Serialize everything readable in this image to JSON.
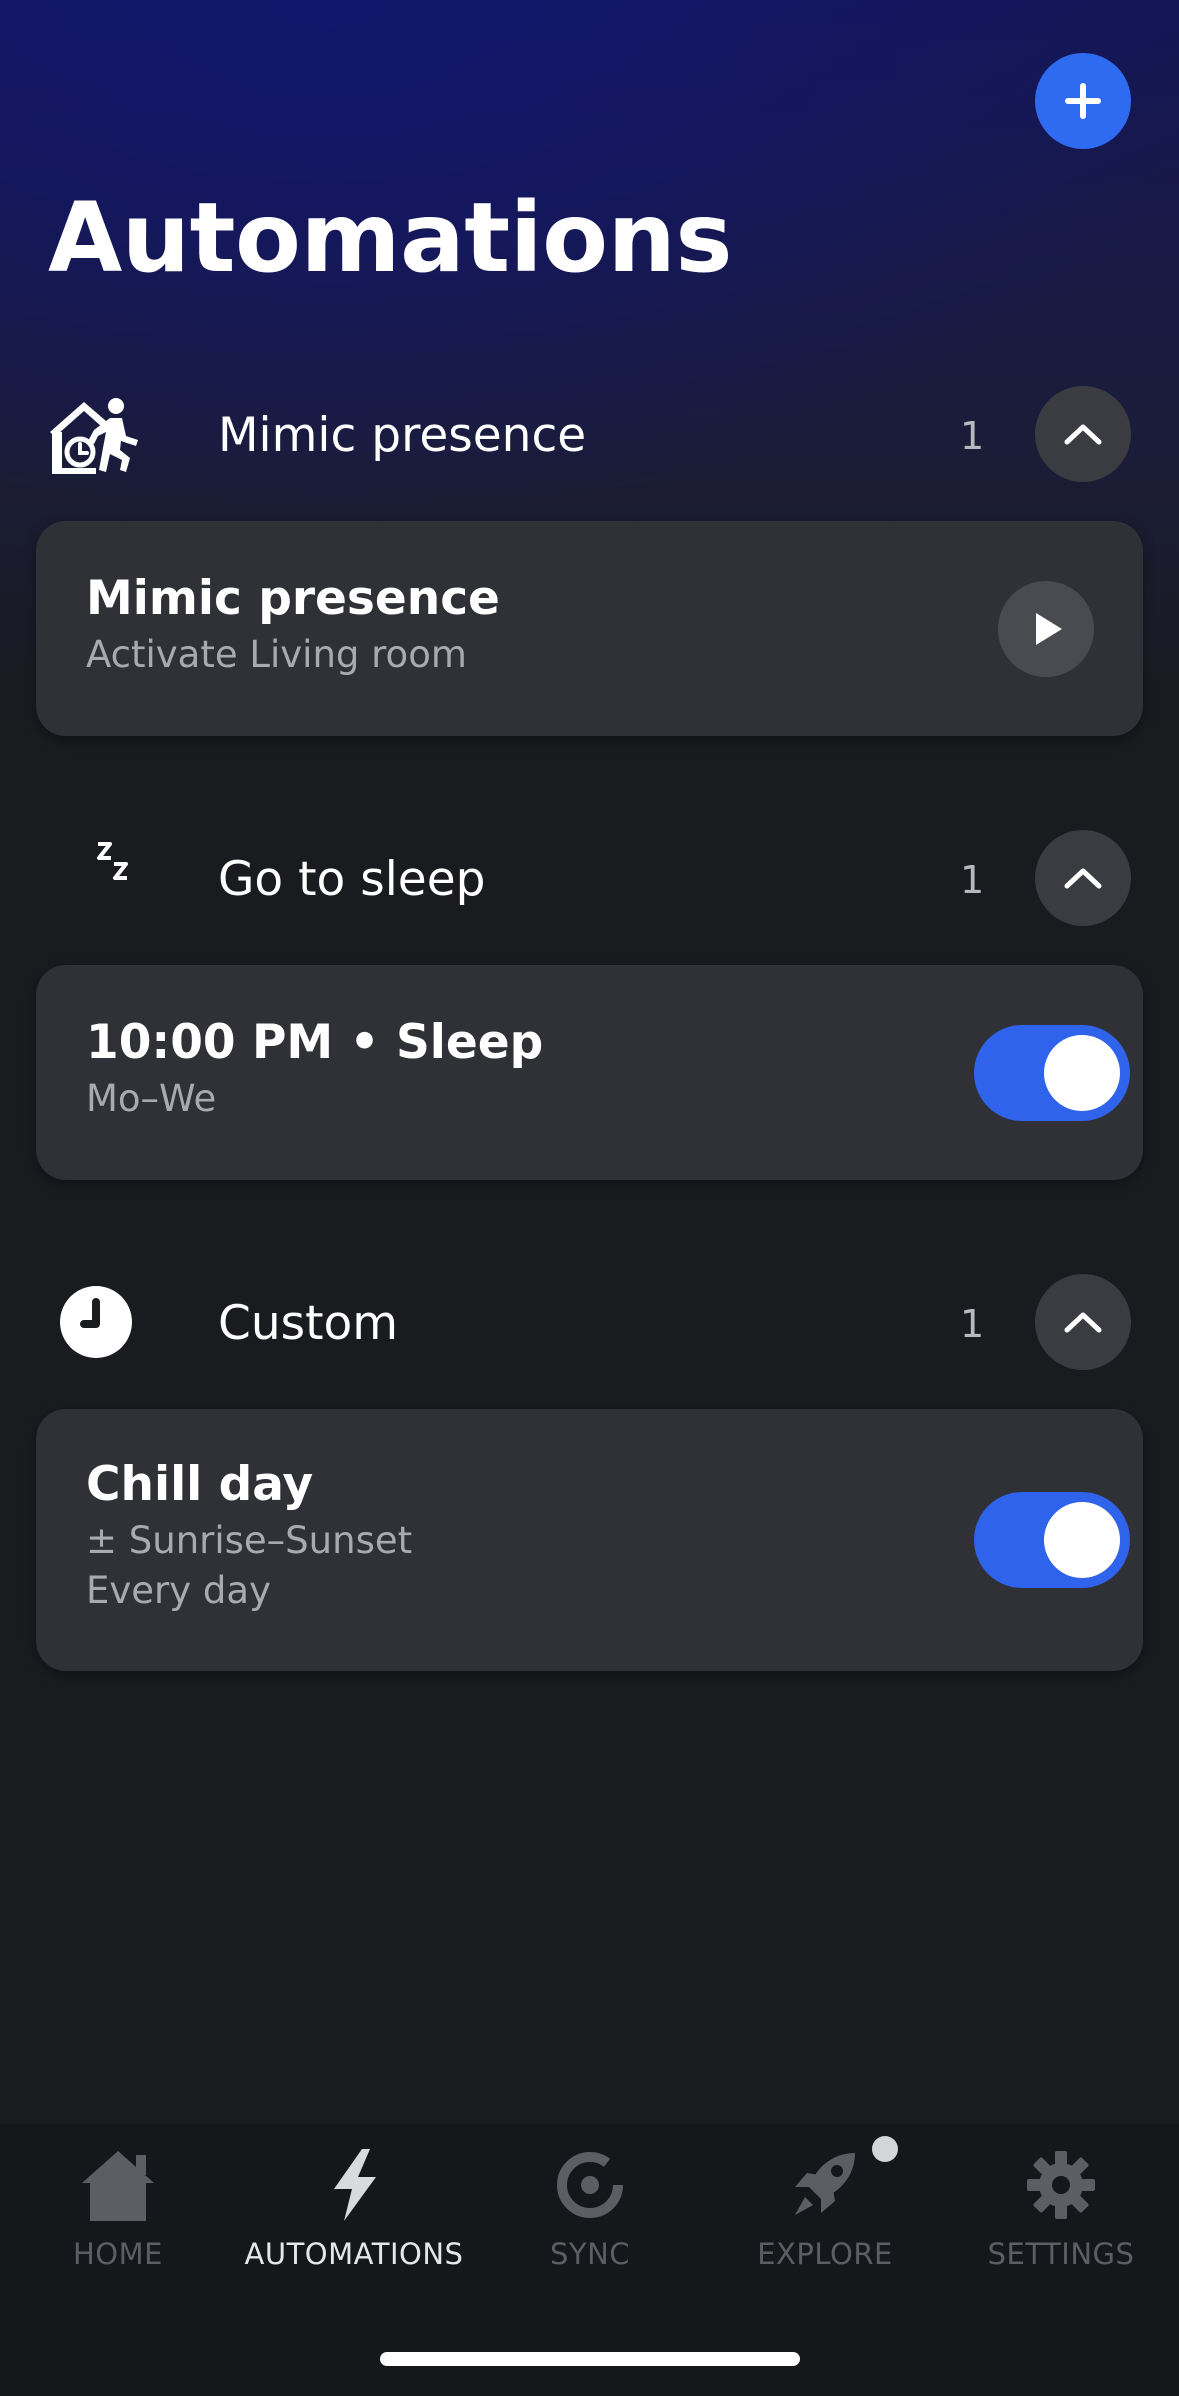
{
  "header": {
    "title": "Automations",
    "add_icon": "plus-icon"
  },
  "groups": [
    {
      "title": "Mimic presence",
      "count": "1",
      "icon": "house-walking-person-icon",
      "card": {
        "title": "Mimic presence",
        "subtitle": "Activate Living room",
        "action": "play"
      }
    },
    {
      "title": "Go to sleep",
      "count": "1",
      "icon": "moon-zzz-icon",
      "card": {
        "title": "10:00 PM • Sleep",
        "subtitle": "Mo–We",
        "enabled": true
      }
    },
    {
      "title": "Custom",
      "count": "1",
      "icon": "clock-icon",
      "card": {
        "title": "Chill day",
        "subtitle": "± Sunrise–Sunset",
        "subtitle2": "Every day",
        "enabled": true
      }
    }
  ],
  "tabbar": {
    "tabs": [
      {
        "label": "HOME",
        "icon": "house-icon",
        "active": false
      },
      {
        "label": "AUTOMATIONS",
        "icon": "lightning-icon",
        "active": true
      },
      {
        "label": "SYNC",
        "icon": "sync-icon",
        "active": false
      },
      {
        "label": "EXPLORE",
        "icon": "rocket-icon",
        "active": false,
        "badge": true
      },
      {
        "label": "SETTINGS",
        "icon": "gear-icon",
        "active": false
      }
    ]
  },
  "colors": {
    "accent": "#2f6bf0",
    "background": "#1a1b1f",
    "card": "#303136",
    "header_gradient": "#141655"
  }
}
